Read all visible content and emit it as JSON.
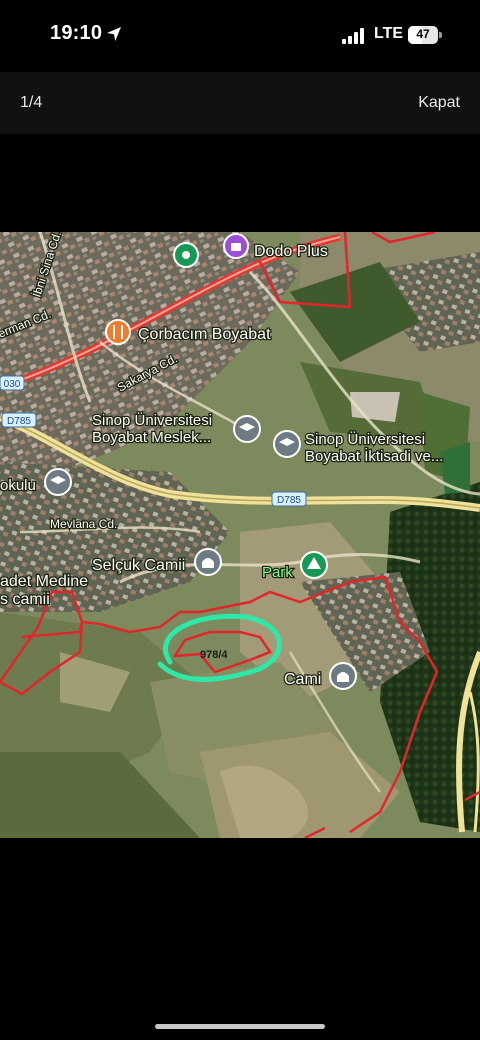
{
  "status_bar": {
    "time": "19:10",
    "carrier": "LTE",
    "battery_percent": "47",
    "icons": [
      "location-arrow-icon",
      "cellular-signal-icon",
      "battery-icon"
    ]
  },
  "viewer": {
    "counter": "1/4",
    "close_label": "Kapat"
  },
  "map": {
    "labels": {
      "ibni_sina": "İbni Sina Cd.",
      "erman": "erman Cd.",
      "dodo_plus": "Dodo Plus",
      "corbacim": "Çorbacım Boyabat",
      "sakarya": "Sakarya Cd.",
      "road_030": "030",
      "d785_left": "D785",
      "d785_mid": "D785",
      "sinop1_line1": "Sinop Üniversitesi",
      "sinop1_line2": "Boyabat Meslek...",
      "sinop2_line1": "Sinop Üniversitesi",
      "sinop2_line2": "Boyabat İktisadi ve...",
      "okulu": "okulu",
      "mevlana": "Mevlana Cd.",
      "selcuk": "Selçuk Camii",
      "park": "Park",
      "medine1": "adet Medine",
      "medine2": "s camii",
      "cami": "Cami",
      "parcel": "978/4"
    },
    "colors": {
      "boundary_red": "#e0262b",
      "highlight_green": "#2ee8a8",
      "road_yellow": "#f1e29a",
      "road_red": "#e03a32",
      "poi_green": "#159a55",
      "poi_purple": "#9b4fd6",
      "poi_orange": "#f07b2a",
      "poi_grey": "#6f7b83"
    }
  }
}
